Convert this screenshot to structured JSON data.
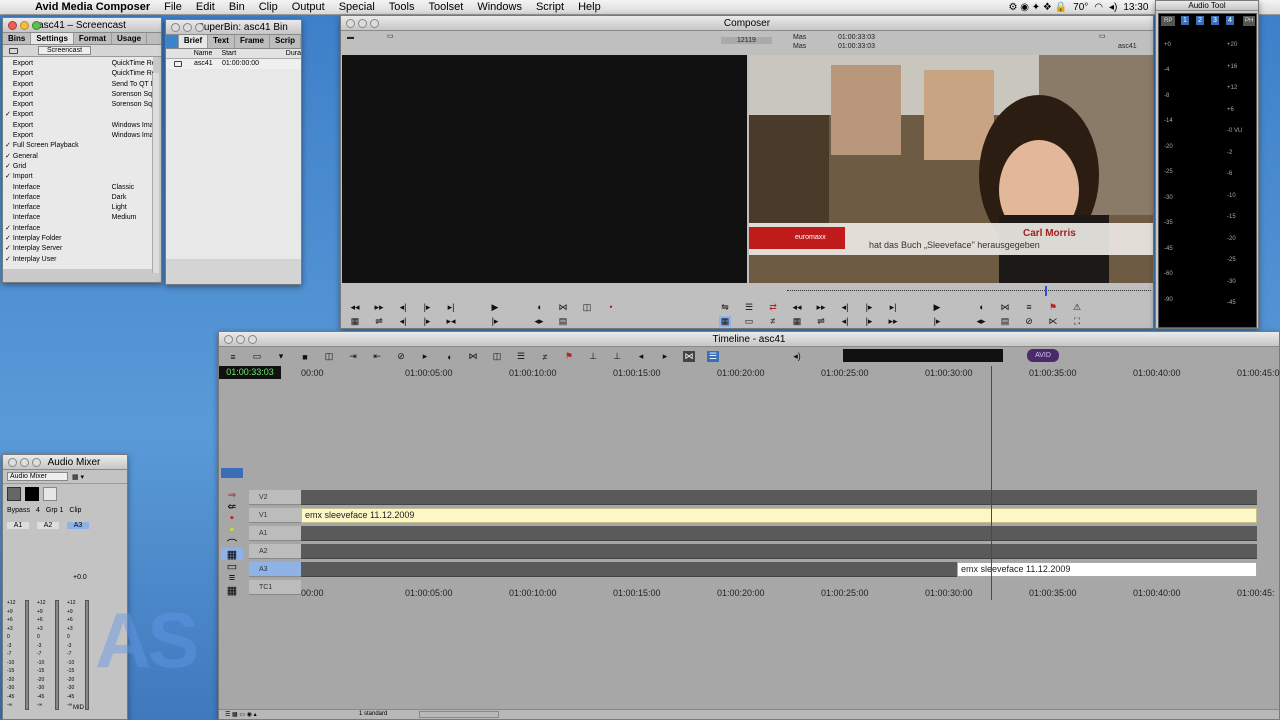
{
  "menubar": {
    "app_name": "Avid Media Composer",
    "items": [
      "File",
      "Edit",
      "Bin",
      "Clip",
      "Output",
      "Special",
      "Tools",
      "Toolset",
      "Windows",
      "Script",
      "Help"
    ],
    "temperature": "70°",
    "clock": "13:30"
  },
  "project_window": {
    "title": "asc41 – Screencast",
    "tabs": [
      "Bins",
      "Settings",
      "Format",
      "Usage"
    ],
    "selected_view": "Screencast",
    "rows": [
      {
        "check": "",
        "name": "Export",
        "value": "QuickTime Re"
      },
      {
        "check": "",
        "name": "Export",
        "value": "QuickTime Re"
      },
      {
        "check": "",
        "name": "Export",
        "value": "Send To QT M"
      },
      {
        "check": "",
        "name": "Export",
        "value": "Sorenson Squ"
      },
      {
        "check": "",
        "name": "Export",
        "value": "Sorenson Squ"
      },
      {
        "check": "✓",
        "name": "Export",
        "value": ""
      },
      {
        "check": "",
        "name": "Export",
        "value": "Windows Ima"
      },
      {
        "check": "",
        "name": "Export",
        "value": "Windows Ima"
      },
      {
        "check": "✓",
        "name": "Full Screen Playback",
        "value": ""
      },
      {
        "check": "✓",
        "name": "General",
        "value": ""
      },
      {
        "check": "✓",
        "name": "Grid",
        "value": ""
      },
      {
        "check": "✓",
        "name": "Import",
        "value": ""
      },
      {
        "check": "",
        "name": "Interface",
        "value": "Classic"
      },
      {
        "check": "",
        "name": "Interface",
        "value": "Dark"
      },
      {
        "check": "",
        "name": "Interface",
        "value": "Light"
      },
      {
        "check": "",
        "name": "Interface",
        "value": "Medium"
      },
      {
        "check": "✓",
        "name": "Interface",
        "value": ""
      },
      {
        "check": "✓",
        "name": "Interplay Folder",
        "value": ""
      },
      {
        "check": "✓",
        "name": "Interplay Server",
        "value": ""
      },
      {
        "check": "✓",
        "name": "Interplay User",
        "value": ""
      }
    ]
  },
  "superbin": {
    "title": "SuperBin: asc41 Bin",
    "tabs": [
      "Brief",
      "Text",
      "Frame",
      "Scrip"
    ],
    "columns": [
      "Name",
      "Start",
      "Dura"
    ],
    "rows": [
      {
        "name": "asc41",
        "start": "01:00:00:00"
      }
    ]
  },
  "composer": {
    "title": "Composer",
    "source_counter": "12119",
    "label_mas_1": "Mas",
    "label_mas_2": "Mas",
    "tc_1": "01:00:33:03",
    "tc_2": "01:00:33:03",
    "sequence": "asc41",
    "lower_third_brand": "euromaxx",
    "lower_third_name": "Carl Morris",
    "lower_third_caption": "hat das Buch „Sleeveface\" herausgegeben"
  },
  "audio_tool": {
    "title": "Audio Tool",
    "buttons": [
      "RP",
      "PH"
    ],
    "channels": [
      "1",
      "2",
      "3",
      "4"
    ],
    "left_scale": [
      "+0",
      "-4",
      "-8",
      "-14",
      "-20",
      "-25",
      "-30",
      "-35",
      "-45",
      "-60",
      "-90"
    ],
    "right_scale": [
      "+20",
      "+16",
      "+12",
      "+6",
      "-0 VU",
      "-2",
      "-6",
      "-10",
      "-15",
      "-20",
      "-25",
      "-30",
      "-45"
    ]
  },
  "timeline": {
    "title": "Timeline - asc41",
    "current_tc": "01:00:33:03",
    "ruler": [
      "00:00",
      "01:00:05:00",
      "01:00:10:00",
      "01:00:15:00",
      "01:00:20:00",
      "01:00:25:00",
      "01:00:30:00",
      "01:00:35:00",
      "01:00:40:00",
      "01:00:45:00"
    ],
    "ruler_bottom": [
      "00:00",
      "01:00:05:00",
      "01:00:10:00",
      "01:00:15:00",
      "01:00:20:00",
      "01:00:25:00",
      "01:00:30:00",
      "01:00:35:00",
      "01:00:40:00",
      "01:00:45:"
    ],
    "tracks": [
      "V2",
      "V1",
      "A1",
      "A2",
      "A3",
      "TC1"
    ],
    "video_clip": "emx sleeveface 11.12.2009",
    "audio_clip": "emx sleeveface 11.12.2009",
    "footer_label": "1 standard"
  },
  "audio_mixer": {
    "title": "Audio Mixer",
    "dropdown": "Audio Mixer",
    "bypass": "Bypass",
    "num": "4",
    "grp": "Grp 1",
    "clip": "Clip",
    "channels": [
      "A1",
      "A2",
      "A3"
    ],
    "gain": "+0.0",
    "scale": [
      "+12",
      "+9",
      "+6",
      "+3",
      "0",
      "-3",
      "-7",
      "-10",
      "-15",
      "-20",
      "-30",
      "-45",
      "-∞"
    ],
    "pan": "MID"
  },
  "watermark": "AS"
}
